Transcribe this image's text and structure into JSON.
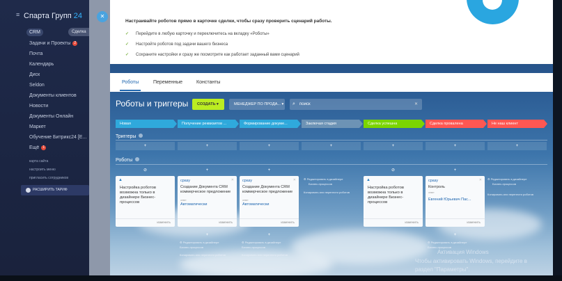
{
  "sidebar": {
    "title": "Спарта Групп",
    "title_num": "24",
    "crm_label": "CRM",
    "items": [
      {
        "label": "Задачи и Проекты",
        "badge": "2"
      },
      {
        "label": "Почта"
      },
      {
        "label": "Календарь"
      },
      {
        "label": "Диск"
      },
      {
        "label": "Seldon"
      },
      {
        "label": "Документы клиентов"
      },
      {
        "label": "Новости"
      },
      {
        "label": "Документы Онлайн"
      },
      {
        "label": "Маркет"
      },
      {
        "label": "Обучение Битрикс24 [Е..."
      },
      {
        "label": "Ещё",
        "badge": "1"
      }
    ],
    "small_links": [
      "карта сайта",
      "настроить меню",
      "пригласить сотрудников"
    ],
    "tariff_button": "РАСШИРИТЬ ТАРИФ"
  },
  "background": {
    "crm_tab": "Сделка"
  },
  "intro": {
    "heading": "Настраивайте роботов прямо в карточке сделки, чтобы сразу проверить сценарий работы.",
    "points": [
      "Перейдите в любую карточку и переключитесь на вкладку «Роботы»",
      "Настройте роботов под задачи вашего бизнеса",
      "Сохраните настройки и сразу же посмотрите как работает заданный вами сценарий"
    ]
  },
  "tabs": [
    "Роботы",
    "Переменные",
    "Константы"
  ],
  "toolbar": {
    "title": "Роботы и триггеры",
    "create": "СОЗДАТЬ",
    "manager": "МЕНЕДЖЕР ПО ПРОДА...",
    "search_placeholder": "поиск"
  },
  "stages": [
    {
      "label": "Новая",
      "color": "#2fa9dc"
    },
    {
      "label": "Получение реквизитов ...",
      "color": "#2fa9dc"
    },
    {
      "label": "Формирование докуме...",
      "color": "#2fa9dc"
    },
    {
      "label": "Заключая стадия",
      "color": "#6d93b5"
    },
    {
      "label": "Сделка успешна",
      "color": "#7bd500"
    },
    {
      "label": "Сделка провалена",
      "color": "#ff5752"
    },
    {
      "label": "Не наш клиент",
      "color": "#ff5752"
    }
  ],
  "sections": {
    "triggers": "Триггеры",
    "robots": "Роботы"
  },
  "cards": [
    {
      "when": "",
      "warn": true,
      "title": "Настройка роботов возможна только в дизайнере Бизнес-процессов",
      "sub": "",
      "link": "",
      "edit": "изменить"
    },
    {
      "when": "сразу",
      "warn": false,
      "title": "Создание Документа CRM коммерческое предложение",
      "sub": "ответ",
      "link": "Автоматически",
      "edit": "изменить"
    },
    {
      "when": "сразу",
      "warn": false,
      "title": "Создание Документа CRM коммерческое предложение",
      "sub": "ответ",
      "link": "Автоматически",
      "edit": "изменить"
    },
    {
      "when": "",
      "warn": true,
      "title": "Настройка роботов возможна только в дизайнере Бизнес-процессов",
      "sub": "",
      "link": "",
      "edit": "изменить"
    },
    {
      "when": "сразу",
      "warn": false,
      "title": "Контроль",
      "sub": "ответ",
      "link": "Евгений Юрьевич Пас...",
      "edit": "изменить"
    }
  ],
  "notes": {
    "edit_design": "Редактировать в дизайнере",
    "bp": "Бизнес-процессов",
    "copy_move": "Копировать или перенести роботов"
  },
  "watermark": {
    "line1": "Активация Windows",
    "line2": "Чтобы активировать Windows, перейдите в",
    "line3": "раздел \"Параметры\"."
  }
}
